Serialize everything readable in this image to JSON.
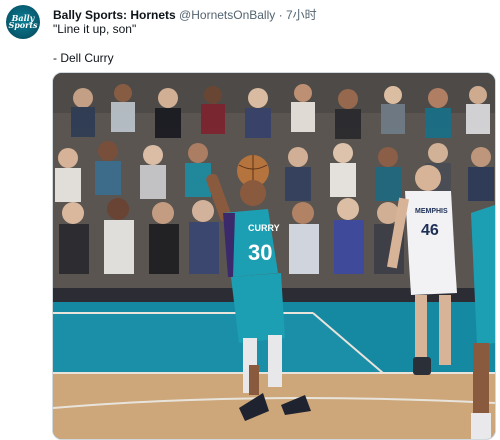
{
  "tweet": {
    "avatar_text": "Bally Sports",
    "display_name": "Bally Sports: Hornets",
    "handle": "@HornetsOnBally",
    "separator": "·",
    "timestamp": "7小时",
    "text_line1": "\"Line it up, son\"",
    "text_line2": "- Dell Curry"
  },
  "media": {
    "jersey_home_name": "CURRY",
    "jersey_home_number": "30",
    "jersey_away_name": "MEMPHIS",
    "jersey_away_number": "46"
  },
  "colors": {
    "hornets_teal": "#1d9fb3",
    "hornets_purple": "#3b2a6b",
    "court_wood": "#cda67a",
    "court_teal": "#1689a2",
    "grizzlies_navy": "#1d2f55"
  }
}
